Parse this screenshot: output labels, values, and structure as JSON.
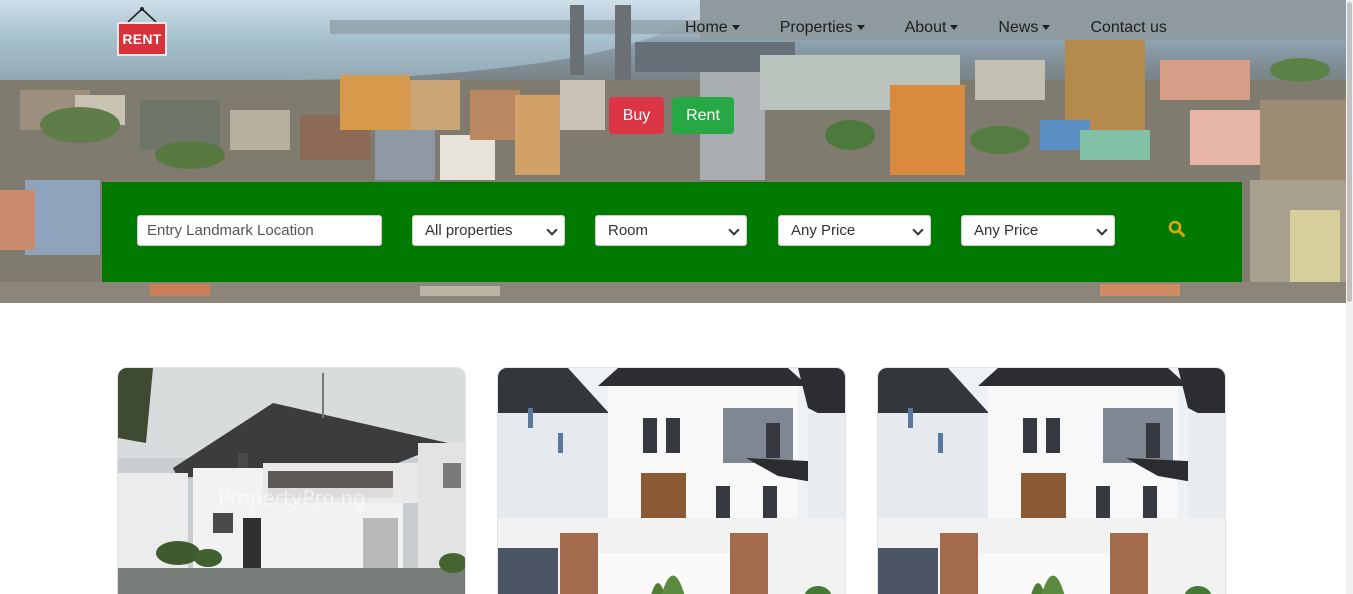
{
  "logo": {
    "text": "RENT"
  },
  "nav": {
    "items": [
      {
        "label": "Home",
        "dropdown": true
      },
      {
        "label": "Properties",
        "dropdown": true
      },
      {
        "label": "About",
        "dropdown": true
      },
      {
        "label": "News",
        "dropdown": true
      },
      {
        "label": "Contact us",
        "dropdown": false
      }
    ]
  },
  "toggle": {
    "buy": "Buy",
    "rent": "Rent"
  },
  "search": {
    "location_placeholder": "Entry Landmark Location",
    "property_type": "All properties",
    "room": "Room",
    "min_price": "Any Price",
    "max_price": "Any Price"
  },
  "colors": {
    "search_panel": "#007a00",
    "buy": "#dc3545",
    "rent": "#28a745",
    "logo": "#d8313a",
    "search_icon": "#e0a800"
  },
  "cards": [
    {
      "image": "two-storey-white-house-with-balcony",
      "watermark": "PropertyPro.ng"
    },
    {
      "image": "modern-white-duplex-with-carport"
    },
    {
      "image": "modern-white-duplex-with-carport"
    }
  ]
}
